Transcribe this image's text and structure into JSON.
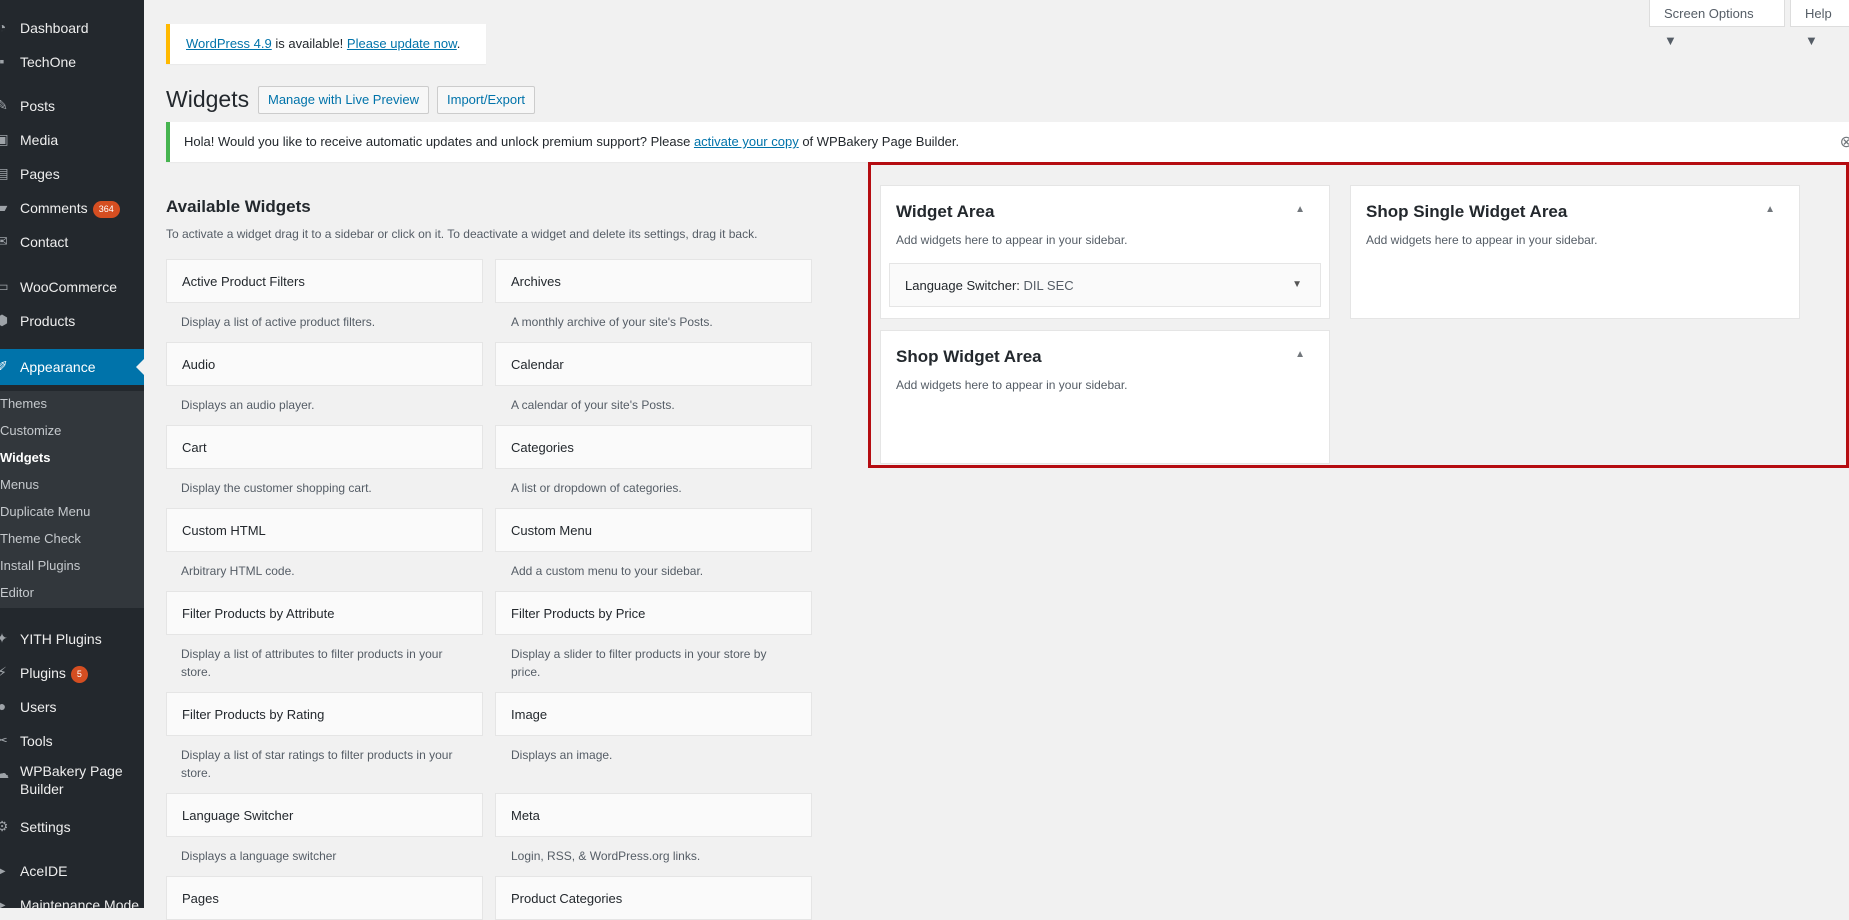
{
  "sidebar": {
    "items": [
      {
        "label": "Dashboard",
        "icon": "dashboard-icon",
        "glyph": "◔"
      },
      {
        "label": "TechOne",
        "icon": "techone-icon",
        "glyph": "▪"
      },
      {
        "label": "Posts",
        "icon": "pushpin-icon",
        "glyph": "✎"
      },
      {
        "label": "Media",
        "icon": "media-icon",
        "glyph": "▣"
      },
      {
        "label": "Pages",
        "icon": "pages-icon",
        "glyph": "▤"
      },
      {
        "label": "Comments",
        "icon": "comments-icon",
        "glyph": "▰",
        "badge": "364"
      },
      {
        "label": "Contact",
        "icon": "mail-icon",
        "glyph": "✉"
      },
      {
        "label": "WooCommerce",
        "icon": "woocommerce-icon",
        "glyph": "▭"
      },
      {
        "label": "Products",
        "icon": "products-icon",
        "glyph": "⬢"
      },
      {
        "label": "Appearance",
        "icon": "appearance-icon",
        "glyph": "✐"
      },
      {
        "label": "YITH Plugins",
        "icon": "yith-icon",
        "glyph": "✦"
      },
      {
        "label": "Plugins",
        "icon": "plugins-icon",
        "glyph": "⚡",
        "badge": "5"
      },
      {
        "label": "Users",
        "icon": "users-icon",
        "glyph": "●"
      },
      {
        "label": "Tools",
        "icon": "tools-icon",
        "glyph": "✂"
      },
      {
        "label": "WPBakery Page Builder",
        "icon": "wpbakery-icon",
        "glyph": "☁"
      },
      {
        "label": "Settings",
        "icon": "settings-icon",
        "glyph": "⚙"
      },
      {
        "label": "AceIDE",
        "icon": "aceide-icon",
        "glyph": "▸"
      },
      {
        "label": "Maintenance Mode",
        "icon": "maintenance-icon",
        "glyph": "▸"
      }
    ],
    "appearance_submenu": [
      "Themes",
      "Customize",
      "Widgets",
      "Menus",
      "Duplicate Menu",
      "Theme Check",
      "Install Plugins",
      "Editor"
    ]
  },
  "top": {
    "screen_options": "Screen Options ▼",
    "help": "Help ▼"
  },
  "update_notice": {
    "link1": "WordPress 4.9",
    "text": " is available! ",
    "link2": "Please update now",
    "end": "."
  },
  "header": {
    "title": "Widgets",
    "live_preview": "Manage with Live Preview",
    "import_export": "Import/Export"
  },
  "wpbakery_notice": {
    "pre": "Hola! Would you like to receive automatic updates and unlock premium support? Please ",
    "link": "activate your copy",
    "post": " of WPBakery Page Builder."
  },
  "available": {
    "title": "Available Widgets",
    "description": "To activate a widget drag it to a sidebar or click on it. To deactivate a widget and delete its settings, drag it back.",
    "widgets": [
      {
        "name": "Active Product Filters",
        "desc": "Display a list of active product filters."
      },
      {
        "name": "Archives",
        "desc": "A monthly archive of your site's Posts."
      },
      {
        "name": "Audio",
        "desc": "Displays an audio player."
      },
      {
        "name": "Calendar",
        "desc": "A calendar of your site's Posts."
      },
      {
        "name": "Cart",
        "desc": "Display the customer shopping cart."
      },
      {
        "name": "Categories",
        "desc": "A list or dropdown of categories."
      },
      {
        "name": "Custom HTML",
        "desc": "Arbitrary HTML code."
      },
      {
        "name": "Custom Menu",
        "desc": "Add a custom menu to your sidebar."
      },
      {
        "name": "Filter Products by Attribute",
        "desc": "Display a list of attributes to filter products in your store."
      },
      {
        "name": "Filter Products by Price",
        "desc": "Display a slider to filter products in your store by price."
      },
      {
        "name": "Filter Products by Rating",
        "desc": "Display a list of star ratings to filter products in your store."
      },
      {
        "name": "Image",
        "desc": "Displays an image."
      },
      {
        "name": "Language Switcher",
        "desc": "Displays a language switcher"
      },
      {
        "name": "Meta",
        "desc": "Login, RSS, & WordPress.org links."
      },
      {
        "name": "Pages",
        "desc": ""
      },
      {
        "name": "Product Categories",
        "desc": ""
      }
    ]
  },
  "sidebars": [
    {
      "title": "Widget Area",
      "desc": "Add widgets here to appear in your sidebar.",
      "widget": {
        "name": "Language Switcher:",
        "instance": "DIL SEC"
      }
    },
    {
      "title": "Shop Single Widget Area",
      "desc": "Add widgets here to appear in your sidebar."
    },
    {
      "title": "Shop Widget Area",
      "desc": "Add widgets here to appear in your sidebar."
    }
  ],
  "glyphs": {
    "collapse": "▲",
    "expand": "▼",
    "dismiss": "⊗"
  },
  "colors": {
    "admin_bar": "#23282d",
    "accent": "#0073aa",
    "highlight_border": "#b50c11",
    "warning": "#ffb900",
    "success": "#46b450"
  }
}
